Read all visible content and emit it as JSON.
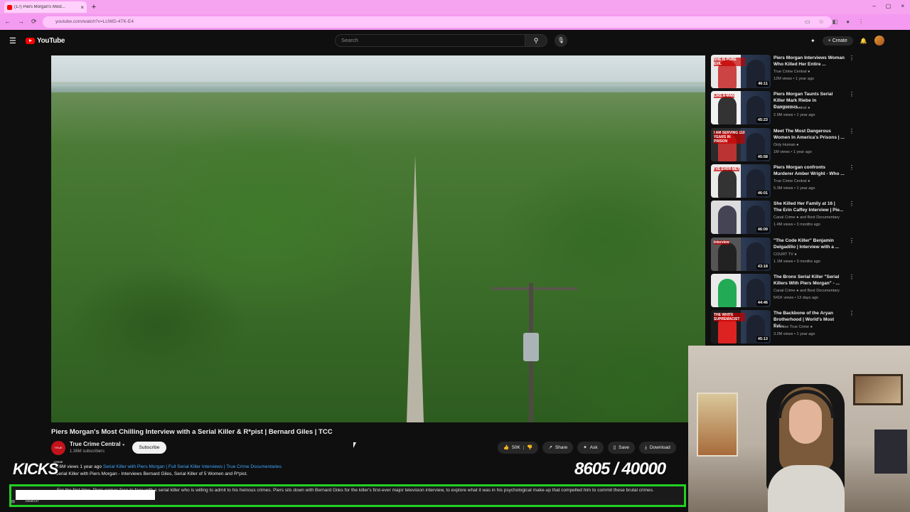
{
  "browser": {
    "tab_title": "(17) Piers Morgan's Most...",
    "url": "youtube.com/watch?v=LUWD-4TK-E4",
    "new_tab": "+",
    "close_tab": "×",
    "window_controls": [
      "–",
      "▢",
      "×"
    ],
    "back": "←",
    "forward": "→",
    "reload": "⟳"
  },
  "youtube": {
    "logo": "YouTube",
    "search_placeholder": "Search",
    "create_label": "Create",
    "icons": [
      "menu-icon",
      "search-icon",
      "mic-icon",
      "cast-icon",
      "bell-icon"
    ]
  },
  "video": {
    "title": "Piers Morgan's Most Chilling Interview with a Serial Killer & R*pist | Bernard Giles | TCC",
    "channel": "True Crime Central",
    "subscribers": "1.36M subscribers",
    "subscribe_label": "Subscribe",
    "channel_avatar_text": "TRUE CRIME",
    "actions": {
      "likes": "50K",
      "share": "Share",
      "ask": "Ask",
      "save": "Save",
      "download": "Download"
    },
    "meta_views": "4.6M views  1 year ago",
    "meta_tags": "Serial Killer with Piers Morgan | Full Serial Killer Interviews | True Crime Documentaries",
    "desc_line": "Serial Killer with Piers Morgan - Interviews Bernard Giles, Serial Killer of 5 Women and R*pist.",
    "ticker_text": "For the first time, Piers comes face to face with a serial killer who is willing to admit to his heinous crimes. Piers sits down with Bernard Giles for the killer's first-ever major television interview, to explore what it was in his psychological make-up that compelled him to commit these brutal crimes."
  },
  "overlay": {
    "kicks_label": "KICKS",
    "count": "8605",
    "goal": "/ 40000",
    "taskbar_search": "Search"
  },
  "recommendations": [
    {
      "title": "Piers Morgan Interviews Woman Who Killed Her Entire ...",
      "channel": "True Crime Central",
      "views": "12M views • 1 year ago",
      "duration": "46:11",
      "thumb_text": "SHE IS PURE EVIL"
    },
    {
      "title": "Piers Morgan Taunts Serial Killer Mark Riebe in Dangerous...",
      "channel": "True Crime Central",
      "views": "2.9M views • 1 year ago",
      "duration": "45:23",
      "thumb_text": "LIKE A MAN"
    },
    {
      "title": "Meet The Most Dangerous Women In America's Prisons | ...",
      "channel": "Only Human",
      "views": "1M views • 1 year ago",
      "duration": "45:58",
      "thumb_text": "I AM SERVING 110 YEARS IN PRISON"
    },
    {
      "title": "Piers Morgan confronts Murderer Amber Wright - Who ...",
      "channel": "True Crime Central",
      "views": "5.3M views • 1 year ago",
      "duration": "46:01",
      "thumb_text": "I'VE EVER MET"
    },
    {
      "title": "She Killed Her Family at 16 | The Erin Caffey Interview | Pie...",
      "channel": "Canal Crime",
      "channel_extra": "and Best Documentary",
      "views": "1.4M views • 3 months ago",
      "duration": "46:09",
      "thumb_text": ""
    },
    {
      "title": "\"The Code Killer\" Benjamin Delgadillo | Interview with a ...",
      "channel": "COURT TV",
      "views": "1.1M views • 3 months ago",
      "duration": "43:18",
      "thumb_text": "Interview"
    },
    {
      "title": "The Bronx Serial Killer \"Serial Killers With Piers Morgan\" - ...",
      "channel": "Canal Crime",
      "channel_extra": "and Best Documentary",
      "views": "541K views • 13 days ago",
      "duration": "44:46",
      "thumb_text": ""
    },
    {
      "title": "The Backbone of the Aryan Brotherhood | World's Most Evi...",
      "channel": "FilmRise True Crime",
      "views": "3.2M views • 1 year ago",
      "duration": "45:13",
      "thumb_text": "THE WHITE SUPREMACIST"
    }
  ]
}
